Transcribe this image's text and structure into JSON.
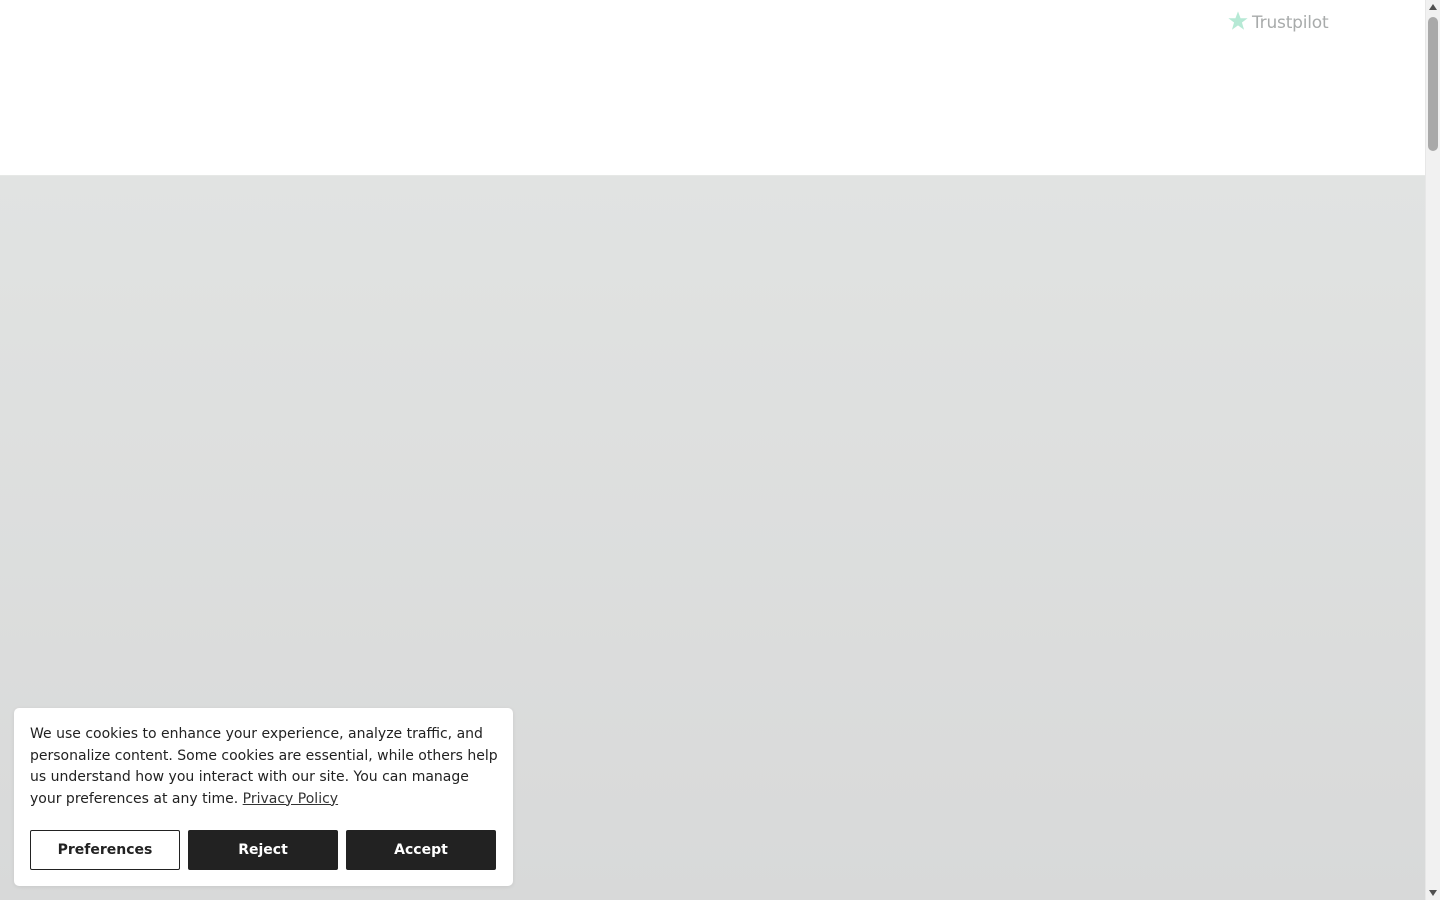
{
  "header": {
    "trustpilot_label": "Trustpilot"
  },
  "cookie_banner": {
    "message": "We use cookies to enhance your experience, analyze traffic, and personalize content. Some cookies are essential, while others help us understand how you interact with our site. You can manage your preferences at any time.",
    "privacy_link_label": "Privacy Policy",
    "preferences_label": "Preferences",
    "reject_label": "Reject",
    "accept_label": "Accept"
  },
  "colors": {
    "trustpilot_star": "#b6e9d5",
    "button_dark": "#222222",
    "hero_background": "#dcdede"
  },
  "icons": {
    "trustpilot": "star-icon"
  }
}
